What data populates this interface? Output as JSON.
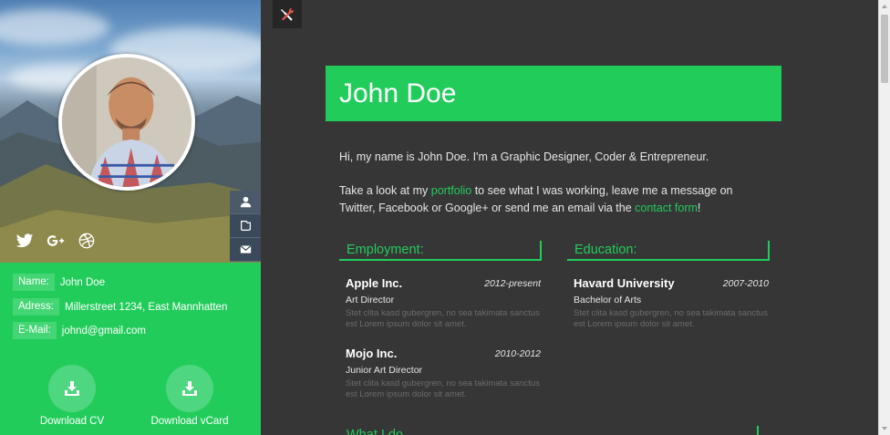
{
  "profile": {
    "name": "John Doe"
  },
  "contact": {
    "name_key": "Name:",
    "name_value": "John Doe",
    "address_key": "Adress:",
    "address_value": "Millerstreet 1234, East Mannhatten",
    "email_key": "E-Mail:",
    "email_value": "johnd@gmail.com"
  },
  "social": {
    "icons": [
      "twitter-icon",
      "google-plus-icon",
      "dribbble-icon"
    ]
  },
  "side_tabs": [
    "user-icon",
    "portfolio-icon",
    "mail-icon"
  ],
  "downloads": {
    "cv_label": "Download CV",
    "vcard_label": "Download vCard"
  },
  "intro": {
    "line1": "Hi, my name is John Doe. I'm a Graphic Designer, Coder & Entrepreneur.",
    "p2_before": "Take a look at my ",
    "p2_link1": "portfolio",
    "p2_mid": " to see what I was working, leave me a message on Twitter, Facebook or Google+ or send me an email via the ",
    "p2_link2": "contact form",
    "p2_after": "!"
  },
  "employment": {
    "heading": "Employment:",
    "items": [
      {
        "title": "Apple Inc.",
        "date": "2012-present",
        "role": "Art Director",
        "desc": "Stet clita kasd gubergren, no sea takimata sanctus est Lorem ipsum dolor sit amet."
      },
      {
        "title": "Mojo Inc.",
        "date": "2010-2012",
        "role": "Junior Art Director",
        "desc": "Stet clita kasd gubergren, no sea takimata sanctus est Lorem ipsum dolor sit amet."
      }
    ]
  },
  "education": {
    "heading": "Education:",
    "items": [
      {
        "title": "Havard University",
        "date": "2007-2010",
        "role": "Bachelor of Arts",
        "desc": "Stet clita kasd gubergren, no sea takimata sanctus est Lorem ipsum dolor sit amet."
      }
    ]
  },
  "next_section": {
    "heading": "What I do"
  },
  "colors": {
    "accent": "#22cc5b",
    "background": "#363636"
  }
}
